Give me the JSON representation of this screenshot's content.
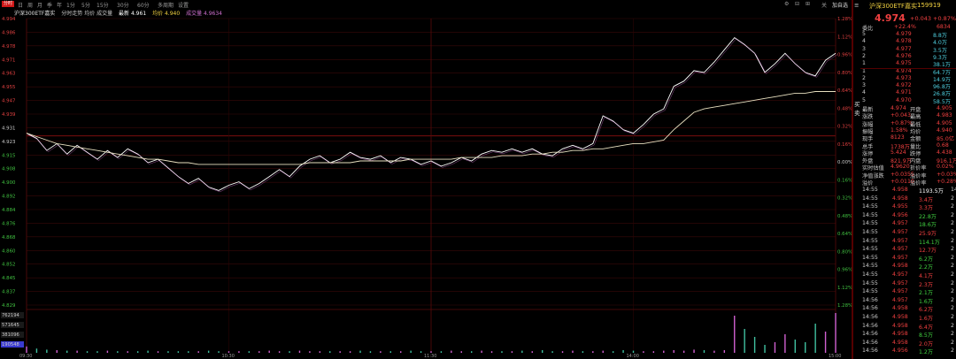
{
  "toolbar": {
    "logo": "分时",
    "items": [
      "日",
      "周",
      "月",
      "季",
      "年",
      "1分",
      "5分",
      "15分",
      "30分",
      "60分",
      "多周期",
      "设置"
    ],
    "right_items": [
      "关",
      "加自选"
    ]
  },
  "info": {
    "name": "沪深300ETF嘉实",
    "vwap_label": "分时走势 均价 成交量",
    "latest": "最新 4.961",
    "avg": "均价 4.940",
    "vol": "成交量 4.9634"
  },
  "quote": {
    "name": "沪深300ETF嘉实",
    "code": "159919",
    "price": "4.974",
    "change": "+0.043",
    "pct": "+0.87%",
    "bid_ratio_label": "委比",
    "bid_ratio": "+22.4%",
    "bid_diff": "6834"
  },
  "orderbook": [
    {
      "label": "5",
      "price": "4.979",
      "vol": "8.8万",
      "c": "#f04040"
    },
    {
      "label": "4",
      "price": "4.978",
      "vol": "4.0万",
      "c": "#f04040"
    },
    {
      "label": "3",
      "price": "4.977",
      "vol": "3.5万",
      "c": "#f04040"
    },
    {
      "label": "2",
      "price": "4.976",
      "vol": "9.3万",
      "c": "#f04040"
    },
    {
      "label": "1",
      "price": "4.975",
      "vol": "38.1万",
      "c": "#f04040"
    },
    {
      "label": "1",
      "price": "4.974",
      "vol": "64.7万",
      "c": "#f04040"
    },
    {
      "label": "2",
      "price": "4.973",
      "vol": "14.9万",
      "c": "#f04040"
    },
    {
      "label": "3",
      "price": "4.972",
      "vol": "96.8万",
      "c": "#f04040"
    },
    {
      "label": "4",
      "price": "4.971",
      "vol": "26.8万",
      "c": "#f04040"
    },
    {
      "label": "5",
      "price": "4.970",
      "vol": "58.5万",
      "c": "#f04040"
    }
  ],
  "stats": [
    {
      "a": "最新",
      "av": "4.974",
      "b": "开盘",
      "bv": "4.905"
    },
    {
      "a": "涨跌",
      "av": "+0.043",
      "b": "最高",
      "bv": "4.983"
    },
    {
      "a": "涨幅",
      "av": "+0.87%",
      "b": "最低",
      "bv": "4.905"
    },
    {
      "a": "振幅",
      "av": "1.58%",
      "b": "均价",
      "bv": "4.940"
    },
    {
      "a": "现手",
      "av": "8123",
      "b": "金额",
      "bv": "85.0亿"
    },
    {
      "a": "总手",
      "av": "1738万",
      "b": "量比",
      "bv": "0.68"
    },
    {
      "a": "涨停",
      "av": "5.424",
      "b": "跌停",
      "bv": "4.438"
    },
    {
      "a": "外盘",
      "av": "821.9万",
      "b": "内盘",
      "bv": "916.1万"
    },
    {
      "a": "实时估值",
      "av": "4.9620",
      "b": "折价率",
      "bv": "0.02%"
    },
    {
      "a": "净值涨跌",
      "av": "+0.0355",
      "b": "溢价率",
      "bv": "+0.03%"
    },
    {
      "a": "溢价",
      "av": "+0.0110",
      "b": "溢价率",
      "bv": "+0.28%"
    }
  ],
  "ticks": [
    {
      "t": "14:55",
      "p": "4.958",
      "v": "1193.5万",
      "c": "#ffffff",
      "n": "14"
    },
    {
      "t": "14:55",
      "p": "4.958",
      "v": "3.4万",
      "c": "#f04040",
      "n": "2"
    },
    {
      "t": "14:55",
      "p": "4.955",
      "v": "3.3万",
      "c": "#f04040",
      "n": "2"
    },
    {
      "t": "14:55",
      "p": "4.956",
      "v": "22.8万",
      "c": "#40d040",
      "n": "2"
    },
    {
      "t": "14:55",
      "p": "4.957",
      "v": "18.6万",
      "c": "#40d040",
      "n": "2"
    },
    {
      "t": "14:55",
      "p": "4.957",
      "v": "25.9万",
      "c": "#f04040",
      "n": "2"
    },
    {
      "t": "14:55",
      "p": "4.957",
      "v": "114.1万",
      "c": "#40d040",
      "n": "2"
    },
    {
      "t": "14:55",
      "p": "4.957",
      "v": "12.7万",
      "c": "#f04040",
      "n": "2"
    },
    {
      "t": "14:55",
      "p": "4.957",
      "v": "6.2万",
      "c": "#40d040",
      "n": "2"
    },
    {
      "t": "14:55",
      "p": "4.958",
      "v": "2.2万",
      "c": "#40d040",
      "n": "2"
    },
    {
      "t": "14:55",
      "p": "4.957",
      "v": "4.1万",
      "c": "#f04040",
      "n": "2"
    },
    {
      "t": "14:55",
      "p": "4.957",
      "v": "2.3万",
      "c": "#f04040",
      "n": "2"
    },
    {
      "t": "14:55",
      "p": "4.957",
      "v": "2.1万",
      "c": "#40d040",
      "n": "2"
    },
    {
      "t": "14:56",
      "p": "4.957",
      "v": "1.6万",
      "c": "#40d040",
      "n": "2"
    },
    {
      "t": "14:56",
      "p": "4.958",
      "v": "6.2万",
      "c": "#f04040",
      "n": "2"
    },
    {
      "t": "14:56",
      "p": "4.958",
      "v": "1.6万",
      "c": "#f04040",
      "n": "2"
    },
    {
      "t": "14:56",
      "p": "4.958",
      "v": "6.4万",
      "c": "#f04040",
      "n": "2"
    },
    {
      "t": "14:56",
      "p": "4.958",
      "v": "8.5万",
      "c": "#40d040",
      "n": "2"
    },
    {
      "t": "14:56",
      "p": "4.958",
      "v": "2.0万",
      "c": "#f04040",
      "n": "2"
    },
    {
      "t": "14:56",
      "p": "4.956",
      "v": "1.2万",
      "c": "#40d040",
      "n": "2"
    }
  ],
  "chart_data": {
    "type": "line",
    "y_left_ticks": [
      "4.994",
      "4.986",
      "4.978",
      "4.971",
      "4.963",
      "4.955",
      "4.947",
      "4.939",
      "4.931",
      "4.923",
      "4.915",
      "4.908",
      "4.900",
      "4.892",
      "4.884",
      "4.876",
      "4.868",
      "4.860",
      "4.852",
      "4.845",
      "4.837",
      "4.829"
    ],
    "y_right_ticks": [
      "1.28%",
      "1.12%",
      "0.96%",
      "0.80%",
      "0.64%",
      "0.48%",
      "0.32%",
      "0.16%",
      "0.00%",
      "0.16%",
      "0.32%",
      "0.48%",
      "0.64%",
      "0.80%",
      "0.96%",
      "1.12%",
      "1.28%"
    ],
    "volume_ticks": [
      "762194",
      "571645",
      "381096",
      "190548"
    ],
    "time_labels": [
      "09:30",
      "10:30",
      "11:30",
      "14:00",
      "15:00"
    ],
    "price": [
      4.928,
      4.925,
      4.918,
      4.922,
      4.916,
      4.921,
      4.917,
      4.913,
      4.918,
      4.914,
      4.919,
      4.916,
      4.911,
      4.913,
      4.908,
      4.903,
      4.899,
      4.902,
      4.897,
      4.895,
      4.898,
      4.9,
      4.896,
      4.899,
      4.903,
      4.907,
      4.903,
      4.909,
      4.913,
      4.915,
      4.911,
      4.913,
      4.917,
      4.914,
      4.913,
      4.915,
      4.911,
      4.914,
      4.913,
      4.91,
      4.912,
      4.909,
      4.911,
      4.914,
      4.912,
      4.916,
      4.918,
      4.917,
      4.919,
      4.917,
      4.919,
      4.916,
      4.915,
      4.919,
      4.921,
      4.919,
      4.922,
      4.938,
      4.935,
      4.93,
      4.928,
      4.933,
      4.939,
      4.942,
      4.955,
      4.958,
      4.964,
      4.963,
      4.969,
      4.976,
      4.983,
      4.979,
      4.974,
      4.963,
      4.968,
      4.974,
      4.968,
      4.963,
      4.961,
      4.97,
      4.974
    ],
    "avg": [
      4.928,
      4.926,
      4.924,
      4.922,
      4.921,
      4.92,
      4.919,
      4.918,
      4.917,
      4.916,
      4.915,
      4.914,
      4.913,
      4.913,
      4.912,
      4.911,
      4.911,
      4.91,
      4.91,
      4.91,
      4.91,
      4.91,
      4.91,
      4.91,
      4.91,
      4.91,
      4.91,
      4.91,
      4.911,
      4.911,
      4.911,
      4.911,
      4.911,
      4.912,
      4.912,
      4.912,
      4.912,
      4.912,
      4.913,
      4.913,
      4.913,
      4.913,
      4.913,
      4.914,
      4.914,
      4.914,
      4.914,
      4.915,
      4.915,
      4.915,
      4.916,
      4.916,
      4.917,
      4.917,
      4.918,
      4.918,
      4.919,
      4.919,
      4.92,
      4.921,
      4.922,
      4.922,
      4.923,
      4.924,
      4.93,
      4.935,
      4.94,
      4.942,
      4.943,
      4.944,
      4.945,
      4.946,
      4.947,
      4.948,
      4.949,
      4.95,
      4.951,
      4.951,
      4.952,
      4.952,
      4.952
    ],
    "volume": [
      12,
      8,
      6,
      5,
      4,
      4,
      3,
      3,
      4,
      3,
      3,
      3,
      4,
      3,
      3,
      3,
      3,
      3,
      4,
      3,
      3,
      3,
      3,
      3,
      4,
      3,
      3,
      4,
      3,
      3,
      3,
      3,
      3,
      4,
      3,
      3,
      3,
      3,
      4,
      3,
      3,
      3,
      4,
      3,
      3,
      4,
      3,
      3,
      3,
      4,
      3,
      5,
      3,
      3,
      4,
      3,
      3,
      4,
      3,
      5,
      4,
      3,
      3,
      4,
      5,
      4,
      6,
      5,
      4,
      5,
      70,
      45,
      30,
      15,
      20,
      35,
      25,
      20,
      55,
      40,
      75
    ],
    "ylim": [
      4.829,
      4.994
    ]
  }
}
